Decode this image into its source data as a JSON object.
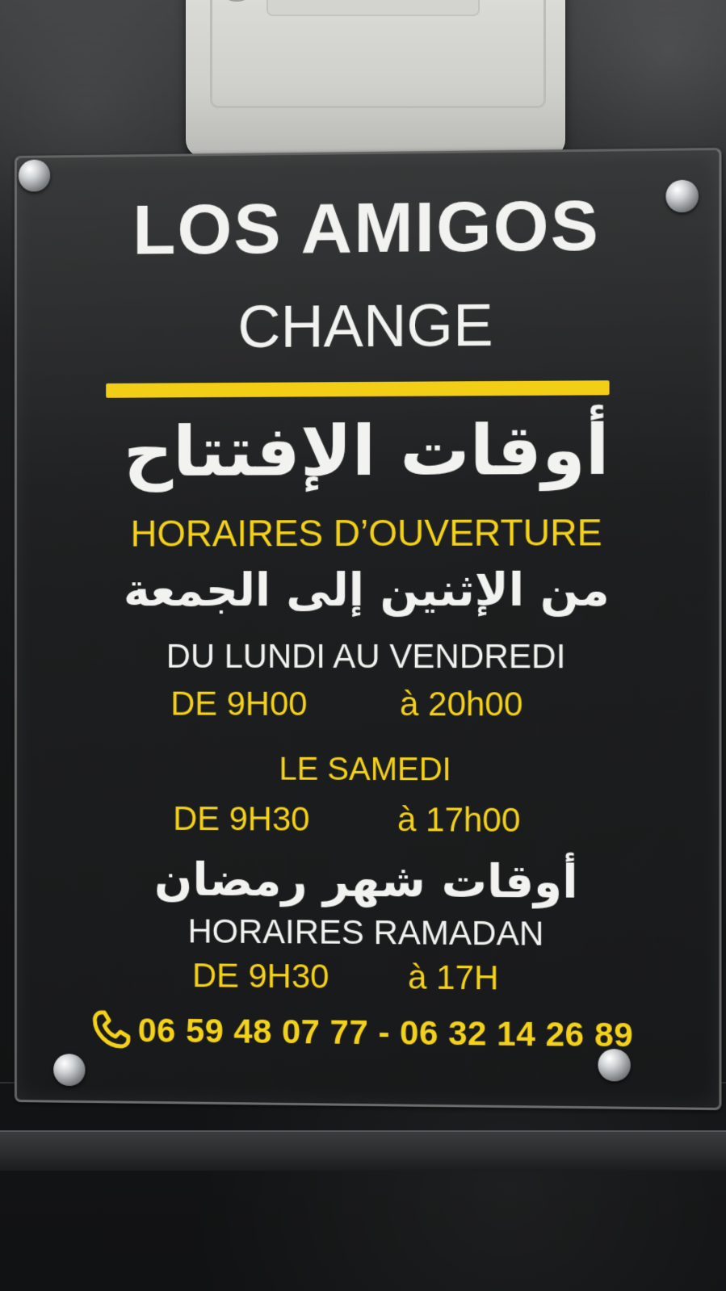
{
  "sign": {
    "brand": "LOS AMIGOS",
    "brand_sub": "CHANGE",
    "arabic_heading": "أوقات الإفتتاح",
    "fr_heading": "HORAIRES D’OUVERTURE",
    "arabic_weekdays": "من الإثنين إلى الجمعة",
    "fr_weekdays": "DU LUNDI AU VENDREDI",
    "weekday_from": "DE 9H00",
    "weekday_to": "à 20h00",
    "saturday_label": "LE SAMEDI",
    "saturday_from": "DE 9H30",
    "saturday_to": "à 17h00",
    "arabic_ramadan": "أوقات شهر رمضان",
    "fr_ramadan": "HORAIRES RAMADAN",
    "ramadan_from": "DE 9H30",
    "ramadan_to": "à 17H",
    "phones": "06 59 48 07 77 - 06 32 14 26 89"
  },
  "icons": {
    "phone": "phone-handset-icon"
  },
  "colors": {
    "text_white": "#f2f2f0",
    "accent_yellow": "#f5d21a",
    "sign_background": "#1d1e1f"
  }
}
